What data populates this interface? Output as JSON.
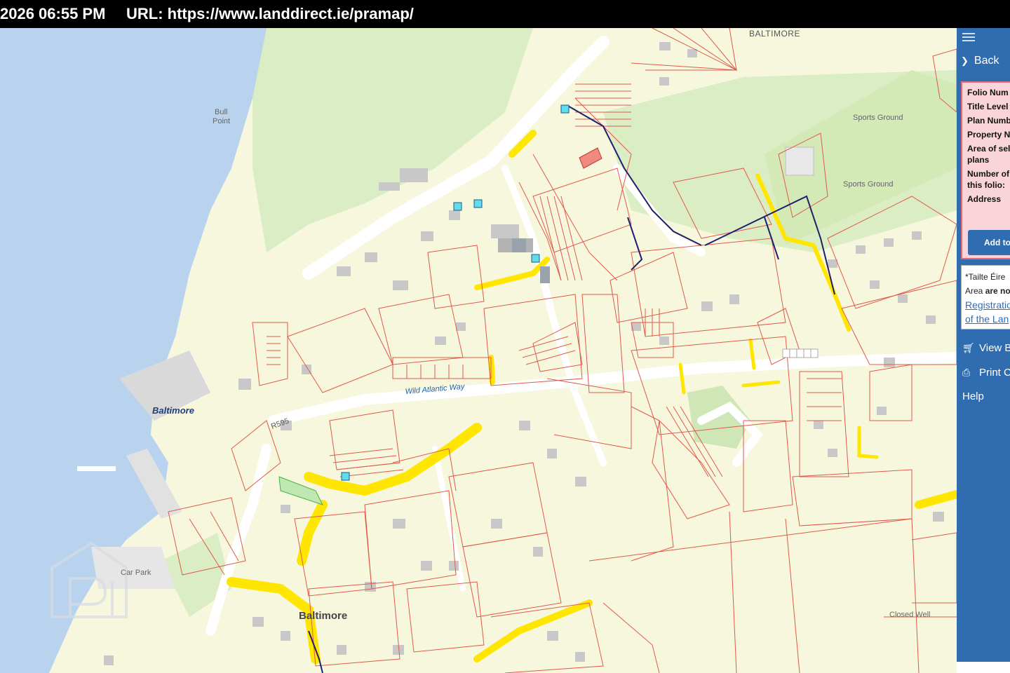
{
  "topbar": {
    "timestamp": "2026 06:55 PM",
    "url": "URL: https://www.landdirect.ie/pramap/"
  },
  "map": {
    "labels": {
      "baltimore_top": "BALTIMORE",
      "bull_point_1": "Bull",
      "bull_point_2": "Point",
      "sports_ground_1": "Sports Ground",
      "sports_ground_2": "Sports Ground",
      "wild_atlantic_way": "Wild Atlantic Way",
      "baltimore_harbour": "Baltimore",
      "r595": "R595",
      "car_park": "Car Park",
      "baltimore_town": "Baltimore",
      "closed_well": "Closed Well"
    },
    "colors": {
      "sea": "#b9d3ef",
      "land": "#f6f7dc",
      "green": "#dbedc4",
      "parcel_line": "#e05a4a",
      "road_highlight": "#ffe600",
      "marker": "#5fdde8",
      "route": "#1f1f6e"
    }
  },
  "sidebar": {
    "menu_icon": "hamburger-icon",
    "back_label": "Back",
    "info": {
      "folio_number": "Folio Num",
      "title_level": "Title Level",
      "plan_number": "Plan Numb",
      "property_no": "Property N",
      "area_label": "Area of sel plans",
      "number_label": "Number of this folio:",
      "address": "Address"
    },
    "add_button": "Add to",
    "notice": {
      "line1": "*Tailte Éire",
      "line2_a": "Area ",
      "line2_b": "are no",
      "link1": "Registratio",
      "link2": "of the Lan"
    },
    "view_label": "View B",
    "print_label": "Print C",
    "help_label": "Help"
  }
}
